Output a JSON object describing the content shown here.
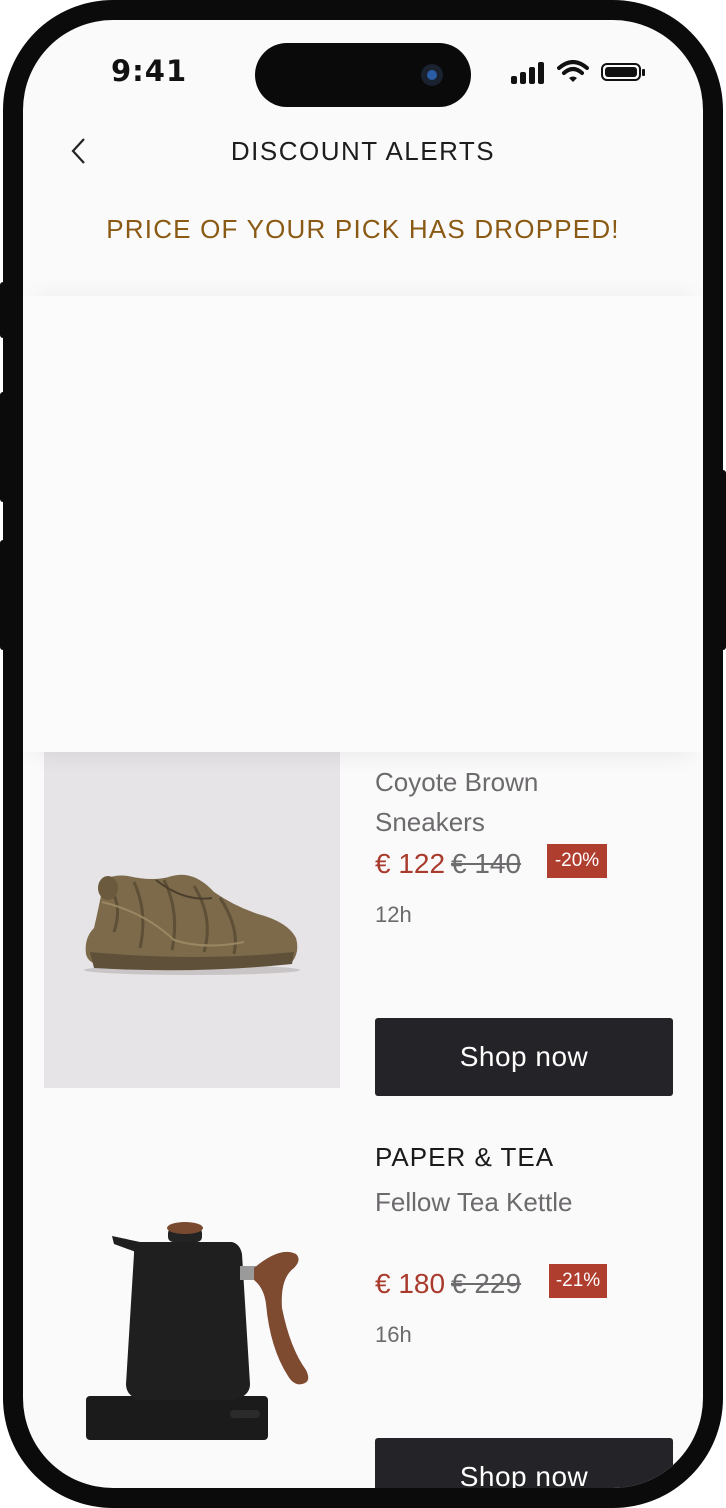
{
  "status": {
    "time": "9:41"
  },
  "header": {
    "title": "DISCOUNT ALERTS",
    "banner": "PRICE OF YOUR PICK HAS DROPPED!"
  },
  "icons": {
    "back": "chevron-left-icon",
    "signal": "cellular-signal-icon",
    "wifi": "wifi-icon",
    "battery": "battery-icon"
  },
  "colors": {
    "banner": "#8a5a14",
    "sale_price": "#a83b2c",
    "discount_badge": "#b03e2f",
    "button": "#242327"
  },
  "products": [
    {
      "brand": "",
      "name": "Coyote Brown Sneakers",
      "price_now": "€ 122",
      "price_old": "€ 140",
      "discount": "-20%",
      "age": "12h",
      "cta": "Shop now",
      "image": "sneaker-image"
    },
    {
      "brand": "PAPER & TEA",
      "name": "Fellow Tea Kettle",
      "price_now": "€ 180",
      "price_old": "€ 229",
      "discount": "-21%",
      "age": "16h",
      "cta": "Shop now",
      "image": "kettle-image"
    }
  ]
}
